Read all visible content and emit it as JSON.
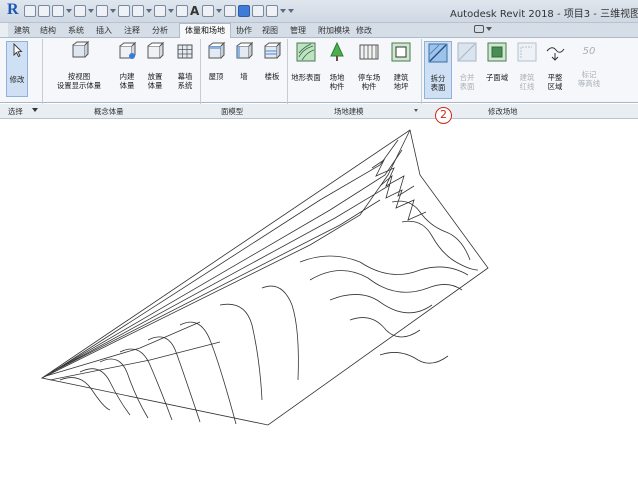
{
  "app": {
    "title": "Autodesk Revit 2018 -   项目3 - 三维视图"
  },
  "tabs": [
    {
      "label": "建筑"
    },
    {
      "label": "结构"
    },
    {
      "label": "系统"
    },
    {
      "label": "插入"
    },
    {
      "label": "注释"
    },
    {
      "label": "分析"
    },
    {
      "label": "体量和场地",
      "active": true
    },
    {
      "label": "协作"
    },
    {
      "label": "视图"
    },
    {
      "label": "管理"
    },
    {
      "label": "附加模块"
    },
    {
      "label": "修改"
    }
  ],
  "ribbon": {
    "modify": {
      "label": "修改"
    },
    "show_mass": {
      "label1": "按视图",
      "label2": "设置显示体量"
    },
    "in_place_mass": {
      "label1": "内建",
      "label2": "体量"
    },
    "place_mass": {
      "label1": "放置",
      "label2": "体量"
    },
    "curtain_system": {
      "label1": "幕墙",
      "label2": "系统"
    },
    "roof": {
      "label": "屋顶"
    },
    "wall": {
      "label": "墙"
    },
    "floor": {
      "label": "楼板"
    },
    "toposurface": {
      "label": "地形表面"
    },
    "site_component": {
      "label1": "场地",
      "label2": "构件"
    },
    "parking_component": {
      "label1": "停车场",
      "label2": "构件"
    },
    "building_pad": {
      "label1": "建筑",
      "label2": "地坪"
    },
    "split_surface": {
      "label1": "拆分",
      "label2": "表面"
    },
    "merge_surfaces": {
      "label1": "合并",
      "label2": "表面"
    },
    "subregion": {
      "label": "子面域"
    },
    "property_line": {
      "label1": "建筑",
      "label2": "红线"
    },
    "graded_region": {
      "label1": "平整",
      "label2": "区域"
    },
    "label_contours": {
      "number": "50",
      "label1": "标记",
      "label2": "等高线"
    }
  },
  "panels": {
    "select": "选择",
    "conceptual_mass": "概念体量",
    "model_by_face": "面模型",
    "site_modeling": "场地建模",
    "modify_site": "修改场地"
  },
  "callout": "2",
  "colors": {
    "accent": "#1c57b5",
    "callout": "#d0271a",
    "lines": "#333333"
  }
}
